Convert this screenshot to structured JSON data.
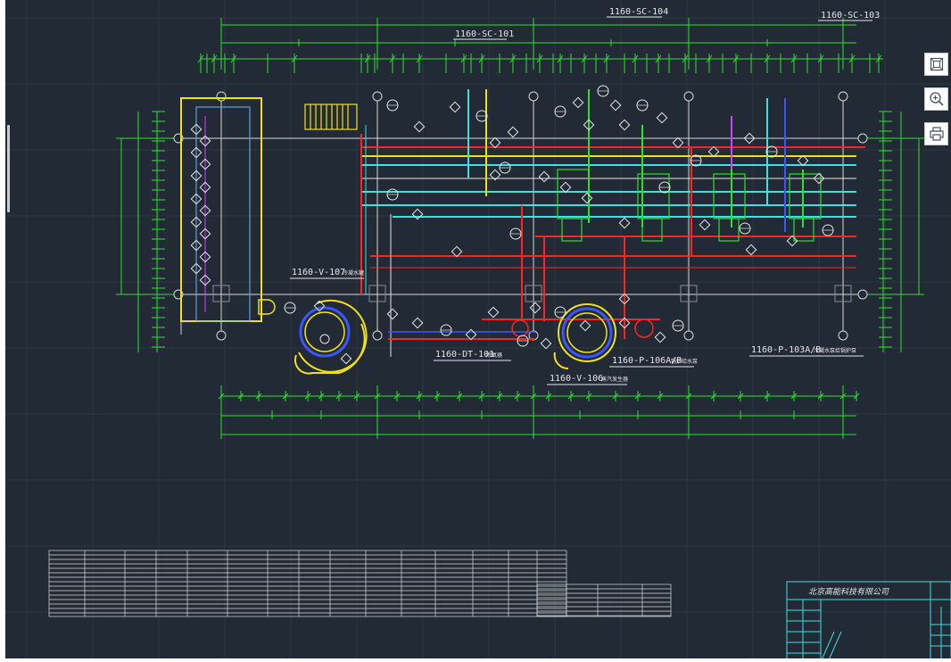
{
  "drawing": {
    "tag_sc104": "1160-SC-104",
    "tag_sc103": "1160-SC-103",
    "tag_sc101": "1160-SC-101",
    "tag_v107": "1160-V-107",
    "tag_v107_desc": "冷凝水罐",
    "tag_dt101": "1160-DT-101",
    "tag_dt101_desc": "除氧器",
    "tag_p106": "1160-P-106A/B",
    "tag_p106_desc": "锅炉给水泵",
    "tag_v106": "1160-V-106",
    "tag_v106_desc": "蒸汽发生器",
    "tag_p103": "1160-P-103A/B",
    "tag_p103_desc": "冷凝水泵给锅炉泵",
    "company": "北京高能科技有限公司"
  },
  "toolbar": {
    "fit_icon": "fit-to-screen-icon",
    "zoom_icon": "zoom-in-icon",
    "print_icon": "print-icon"
  },
  "colors": {
    "background": "#222a35",
    "grid": "#2d3744",
    "green": "#2ee02e",
    "cyan": "#3fe0e0",
    "white": "#e6e6e6",
    "red": "#ff2424",
    "yellow": "#f2e11a",
    "blue": "#3a57ff",
    "magenta": "#d040ff"
  }
}
